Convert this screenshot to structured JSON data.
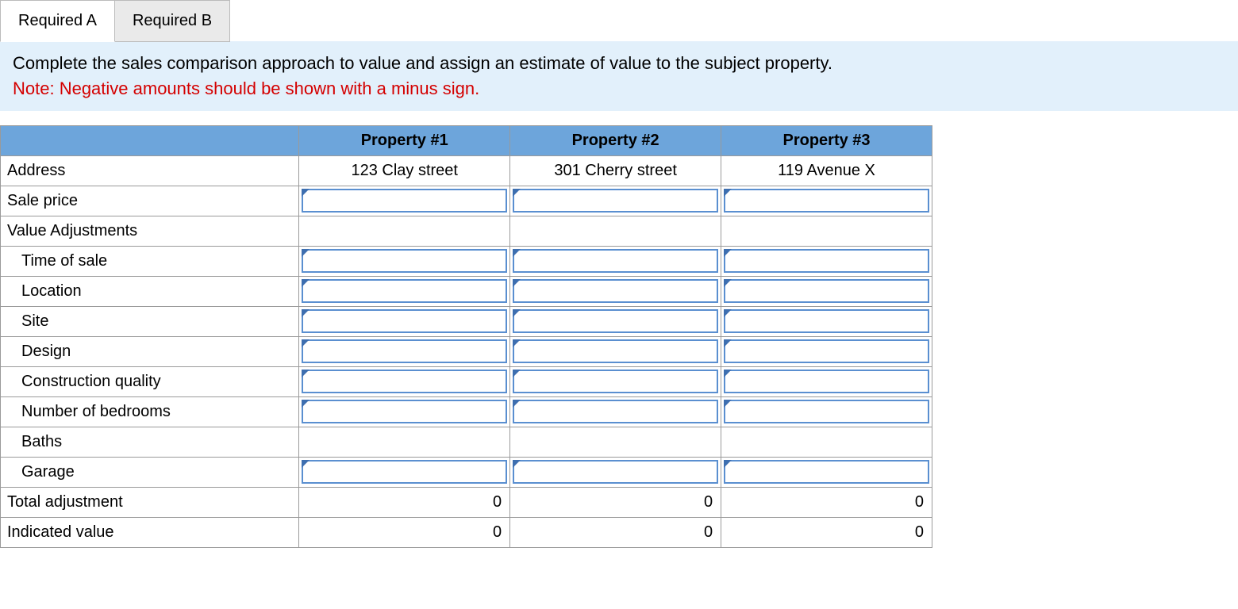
{
  "tabs": {
    "a": "Required A",
    "b": "Required B",
    "active": "a"
  },
  "instruction": {
    "line1": "Complete the sales comparison approach to value and assign an estimate of value to the subject property.",
    "note": "Note: Negative amounts should be shown with a minus sign."
  },
  "headers": {
    "p1": "Property #1",
    "p2": "Property #2",
    "p3": "Property #3"
  },
  "rows": {
    "address": {
      "label": "Address",
      "type": "display",
      "v": {
        "p1": "123 Clay street",
        "p2": "301 Cherry street",
        "p3": "119 Avenue X"
      }
    },
    "sale_price": {
      "label": "Sale price",
      "type": "input",
      "v": {
        "p1": "",
        "p2": "",
        "p3": ""
      }
    },
    "value_adj": {
      "label": "Value Adjustments",
      "type": "blank"
    },
    "time_of_sale": {
      "label": "Time of sale",
      "type": "input",
      "indent": true,
      "v": {
        "p1": "",
        "p2": "",
        "p3": ""
      }
    },
    "location": {
      "label": "Location",
      "type": "input",
      "indent": true,
      "v": {
        "p1": "",
        "p2": "",
        "p3": ""
      }
    },
    "site": {
      "label": "Site",
      "type": "input",
      "indent": true,
      "v": {
        "p1": "",
        "p2": "",
        "p3": ""
      }
    },
    "design": {
      "label": "Design",
      "type": "input",
      "indent": true,
      "v": {
        "p1": "",
        "p2": "",
        "p3": ""
      }
    },
    "construction": {
      "label": "Construction quality",
      "type": "input",
      "indent": true,
      "v": {
        "p1": "",
        "p2": "",
        "p3": ""
      }
    },
    "bedrooms": {
      "label": "Number of bedrooms",
      "type": "input",
      "indent": true,
      "v": {
        "p1": "",
        "p2": "",
        "p3": ""
      }
    },
    "baths": {
      "label": "Baths",
      "type": "blank",
      "indent": true
    },
    "garage": {
      "label": "Garage",
      "type": "input",
      "indent": true,
      "v": {
        "p1": "",
        "p2": "",
        "p3": ""
      }
    },
    "total_adj": {
      "label": "Total adjustment",
      "type": "result",
      "v": {
        "p1": "0",
        "p2": "0",
        "p3": "0"
      }
    },
    "indicated": {
      "label": "Indicated value",
      "type": "result",
      "v": {
        "p1": "0",
        "p2": "0",
        "p3": "0"
      }
    }
  }
}
